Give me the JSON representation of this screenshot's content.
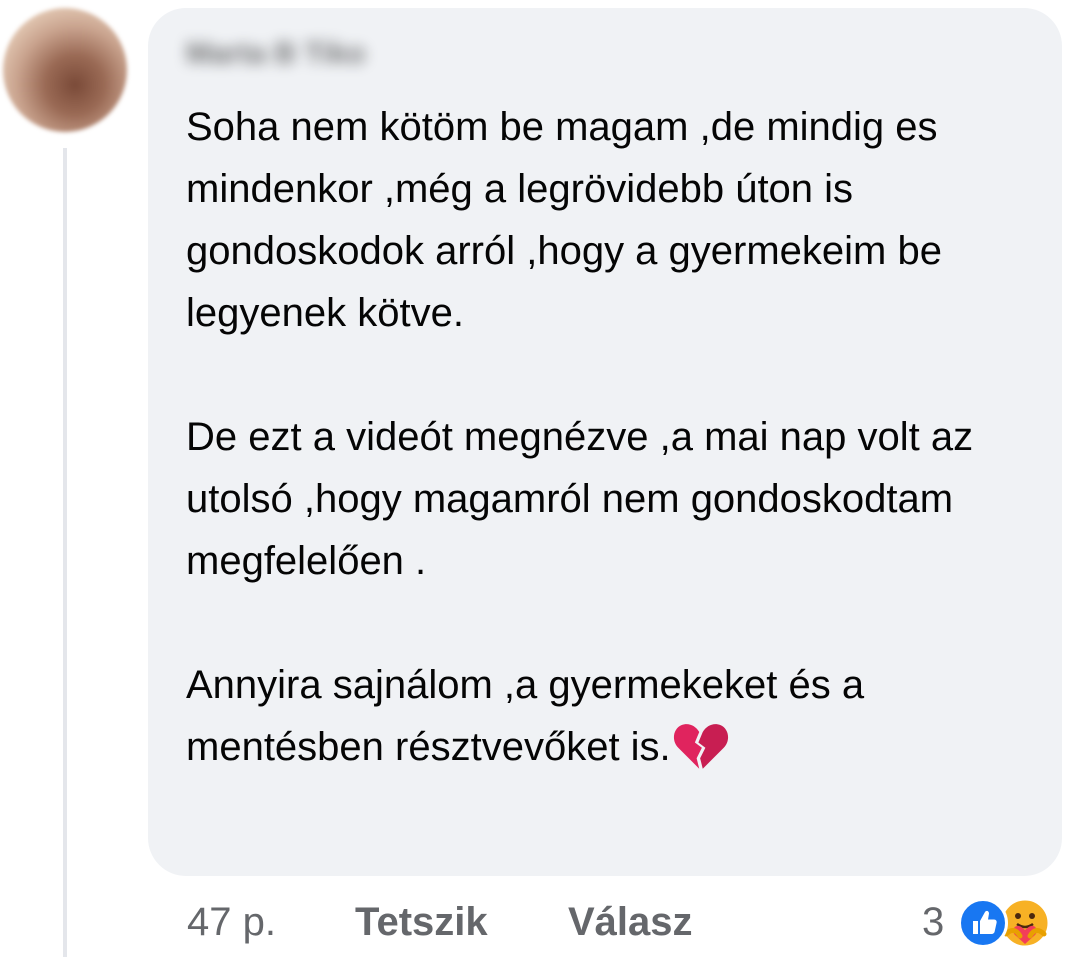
{
  "comment": {
    "author": "Marta B Tiko",
    "paragraphs": [
      "Soha nem kötöm be magam ,de mindig es mindenkor ,még a legrövidebb úton is gondoskodok arról ,hogy a gyermekeim be legyenek kötve.",
      "De ezt a videót megnézve ,a mai nap volt az utolsó ,hogy magamról nem gondoskodtam megfelelően .",
      "Annyira sajnálom ,a gyermekeket és a mentésben résztvevőket is."
    ],
    "emoji": "broken-heart-icon"
  },
  "actions": {
    "time": "47 p.",
    "like_label": "Tetszik",
    "reply_label": "Válasz"
  },
  "reactions": {
    "count": "3",
    "icons": [
      "like-reaction-icon",
      "care-reaction-icon"
    ]
  },
  "colors": {
    "bubble_bg": "#f0f2f5",
    "text": "#050505",
    "meta_text": "#65676b",
    "like_blue": "#1877f2",
    "broken_heart": "#e0245e"
  }
}
